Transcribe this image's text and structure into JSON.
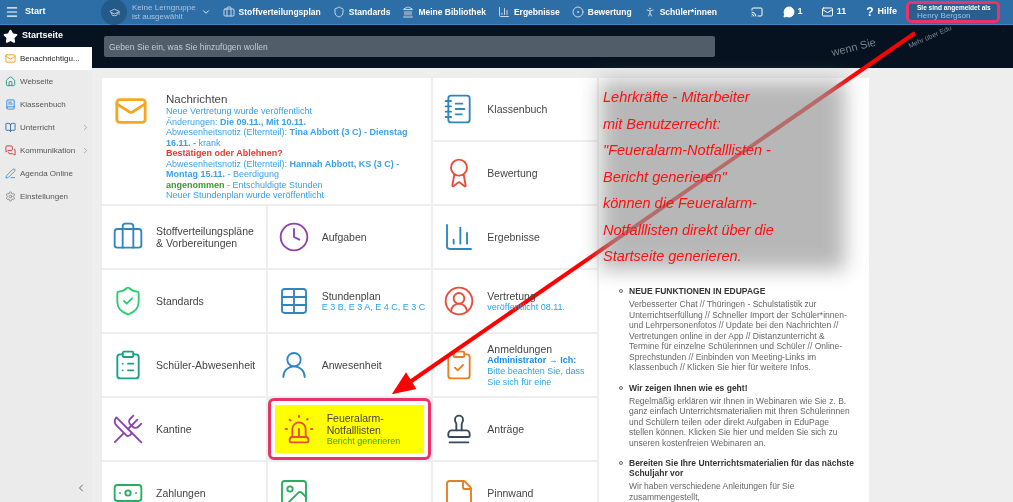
{
  "header": {
    "menu_label": "Start",
    "group_selector": {
      "line1": "Keine Lerngruppe",
      "line2": "ist ausgewählt"
    },
    "nav": [
      "Stoffverteilungsplan",
      "Standards",
      "Meine Bibliothek",
      "Ergebnisse",
      "Bewertung",
      "Schüler*innen"
    ],
    "chat_count": "1",
    "mail_count": "11",
    "help_glyph": "?",
    "help_label": "Hilfe",
    "user": {
      "caption": "Sie sind angemeldet als",
      "name": "Henry Bergson",
      "highlighted": true
    }
  },
  "sidebar": {
    "title": "Startseite",
    "items": [
      {
        "label": "Benachrichtigu...",
        "selected": true,
        "expandable": false
      },
      {
        "label": "Webseite",
        "selected": false,
        "expandable": false
      },
      {
        "label": "Klassenbuch",
        "selected": false,
        "expandable": false
      },
      {
        "label": "Unterricht",
        "selected": false,
        "expandable": true
      },
      {
        "label": "Kommunikation",
        "selected": false,
        "expandable": true
      },
      {
        "label": "Agenda Online",
        "selected": false,
        "expandable": false
      },
      {
        "label": "Einstellungen",
        "selected": false,
        "expandable": false
      }
    ]
  },
  "search": {
    "placeholder": "Geben Sie ein, was Sie hinzufügen wollen"
  },
  "banner_texts": [
    "wenn Sie",
    "Mehr über Edu"
  ],
  "tiles": [
    {
      "kind": "messages",
      "title": "Nachrichten",
      "messages": [
        {
          "kind": "info",
          "text": "Neue Vertretung wurde veröffentlicht"
        },
        {
          "kind": "info",
          "text": "Änderungen: **Die 09.11., Mit 10.11.**"
        },
        {
          "kind": "info",
          "text": "Abwesenheitsnotiz (Elternteil): **Tina Abbott (3 C) - Dienstag 16.11. -** krank"
        },
        {
          "kind": "alert",
          "text": "Bestätigen oder Ablehnen?"
        },
        {
          "kind": "info",
          "text": "Abwesenheitsnotiz (Elternteil): **Hannah Abbott, KS (3 C) - Montag 15.11.** - Beerdigung"
        },
        {
          "kind": "status",
          "status": "angenommen",
          "text": "- Entschuldigte Stunden"
        },
        {
          "kind": "info",
          "text": "Neuer Stundenplan wurde veröffentlicht"
        }
      ]
    },
    {
      "kind": "tile",
      "title": "Klassenbuch",
      "highlighted": false
    },
    {
      "kind": "tile",
      "title": "Bewertung",
      "highlighted": false
    },
    {
      "kind": "tile",
      "title": "Stoffverteilungspläne & Vorbereitungen",
      "highlighted": false
    },
    {
      "kind": "tile",
      "title": "Aufgaben",
      "highlighted": false
    },
    {
      "kind": "tile",
      "title": "Ergebnisse",
      "highlighted": false
    },
    {
      "kind": "tile",
      "title": "Standards",
      "highlighted": false
    },
    {
      "kind": "tile",
      "title": "Stundenplan",
      "highlighted": false,
      "notes": [
        {
          "kind": "link",
          "text": "E 3 B, E 3 A, E 4 C, E 3 C"
        }
      ]
    },
    {
      "kind": "tile",
      "title": "Vertretung",
      "highlighted": false,
      "notes": [
        {
          "kind": "link",
          "text": "veröffentlicht 08.11."
        }
      ]
    },
    {
      "kind": "tile",
      "title": "Schüler-Abwesenheit",
      "highlighted": false
    },
    {
      "kind": "tile",
      "title": "Anwesenheit",
      "highlighted": false
    },
    {
      "kind": "tile",
      "title": "Anmeldungen",
      "highlighted": false,
      "notes": [
        {
          "kind": "strong",
          "text": "Administrator → Ich:"
        },
        {
          "kind": "link",
          "text": "Bitte beachten Sie, dass Sie sich für eine"
        }
      ]
    },
    {
      "kind": "tile",
      "title": "Kantine",
      "highlighted": false
    },
    {
      "kind": "tile",
      "title": "Feueralarm-Notfalllisten",
      "highlighted": true,
      "notes": [
        {
          "kind": "success",
          "text": "Bericht generieren"
        }
      ]
    },
    {
      "kind": "tile",
      "title": "Anträge",
      "highlighted": false
    },
    {
      "kind": "tile",
      "title": "Zahlungen",
      "highlighted": false
    },
    {
      "kind": "tile",
      "highlighted": false
    },
    {
      "kind": "tile",
      "title": "Pinnwand",
      "highlighted": false
    }
  ],
  "annotation": {
    "lines": [
      "Lehrkräfte - Mitarbeiter",
      "mit Benutzerrecht:",
      "\"Feueralarm-Notfalllisten -",
      "Bericht generieren\"",
      "können die Feueralarm-",
      "Notfalllisten direkt über die",
      "Startseite generieren."
    ]
  },
  "news": [
    {
      "heading": "NEUE FUNKTIONEN IN EDUPAGE",
      "body": "Verbesserter Chat // Thüringen - Schulstatistik zur Unterrichtserfüllung // Schneller Import der Schüler*innen- und Lehrpersonenfotos // Update bei den Nachrichten // Vertretungen online in der App // Distanzunterricht & Termine für einzelne Schülerinnen und Schüler // Online-Sprechstunden //  Einbinden von Meeting-Links im Klassenbuch // Klicken Sie hier für weitere Infos."
    },
    {
      "heading": "Wir zeigen Ihnen wie es geht!",
      "body": "Regelmäßig erklären wir Ihnen in Webinaren wie Sie z. B. ganz einfach Unterrichtsmaterialien mit Ihren Schülerinnen und Schülern teilen oder direkt Aufgaben in EduPage stellen können. Klicken Sie hier und melden Sie sich zu unseren kostenfreien Webinaren an."
    },
    {
      "heading": "Bereiten Sie Ihre Unterrichtsmaterialien für das nächste Schuljahr vor",
      "body": "Wir haben verschiedene Anleitungen für Sie zusammengestellt,"
    }
  ]
}
